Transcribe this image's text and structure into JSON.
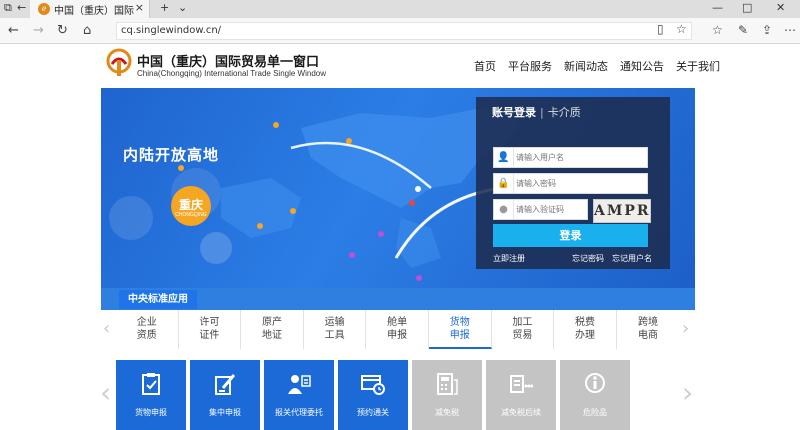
{
  "browser": {
    "tab_title": "中国（重庆）国际贸易...",
    "url": "cq.singlewindow.cn/"
  },
  "site": {
    "name": "中国（重庆）国际贸易单一窗口",
    "subtitle": "China(Chongqing) International Trade Single Window",
    "nav": [
      "首页",
      "平台服务",
      "新闻动态",
      "通知公告",
      "关于我们"
    ]
  },
  "banner": {
    "slogan": "内陆开放高地",
    "city": "重庆",
    "city_en": "CHONGQING"
  },
  "login": {
    "tab_account": "账号登录",
    "tab_card": "卡介质",
    "username_placeholder": "请输入用户名",
    "password_placeholder": "请输入密码",
    "captcha_placeholder": "请输入验证码",
    "captcha_text": "AMPR",
    "submit": "登录",
    "register": "立即注册",
    "forgot_password": "忘记密码",
    "forgot_username": "忘记用户名"
  },
  "section": {
    "title": "中央标准应用"
  },
  "categories": [
    {
      "l1": "企业",
      "l2": "资质"
    },
    {
      "l1": "许可",
      "l2": "证件"
    },
    {
      "l1": "原产",
      "l2": "地证"
    },
    {
      "l1": "运输",
      "l2": "工具"
    },
    {
      "l1": "舱单",
      "l2": "申报"
    },
    {
      "l1": "货物",
      "l2": "申报"
    },
    {
      "l1": "加工",
      "l2": "贸易"
    },
    {
      "l1": "税费",
      "l2": "办理"
    },
    {
      "l1": "跨境",
      "l2": "电商"
    }
  ],
  "tiles": [
    {
      "label": "货物申报",
      "icon": "clipboard-check-icon"
    },
    {
      "label": "集中申报",
      "icon": "pen-document-icon"
    },
    {
      "label": "报关代理委托",
      "icon": "agent-users-icon"
    },
    {
      "label": "预约通关",
      "icon": "card-clock-icon"
    },
    {
      "label": "减免税",
      "icon": "calculator-icon"
    },
    {
      "label": "减免税后续",
      "icon": "tax-followup-icon"
    },
    {
      "label": "危险品",
      "icon": "hazard-info-icon"
    }
  ],
  "colors": {
    "primary": "#1b6ad8",
    "banner": "#2b7ee6",
    "login_button": "#1ab0ee",
    "city_pin": "#f5a623",
    "disabled_tile": "#c4c4c4"
  }
}
